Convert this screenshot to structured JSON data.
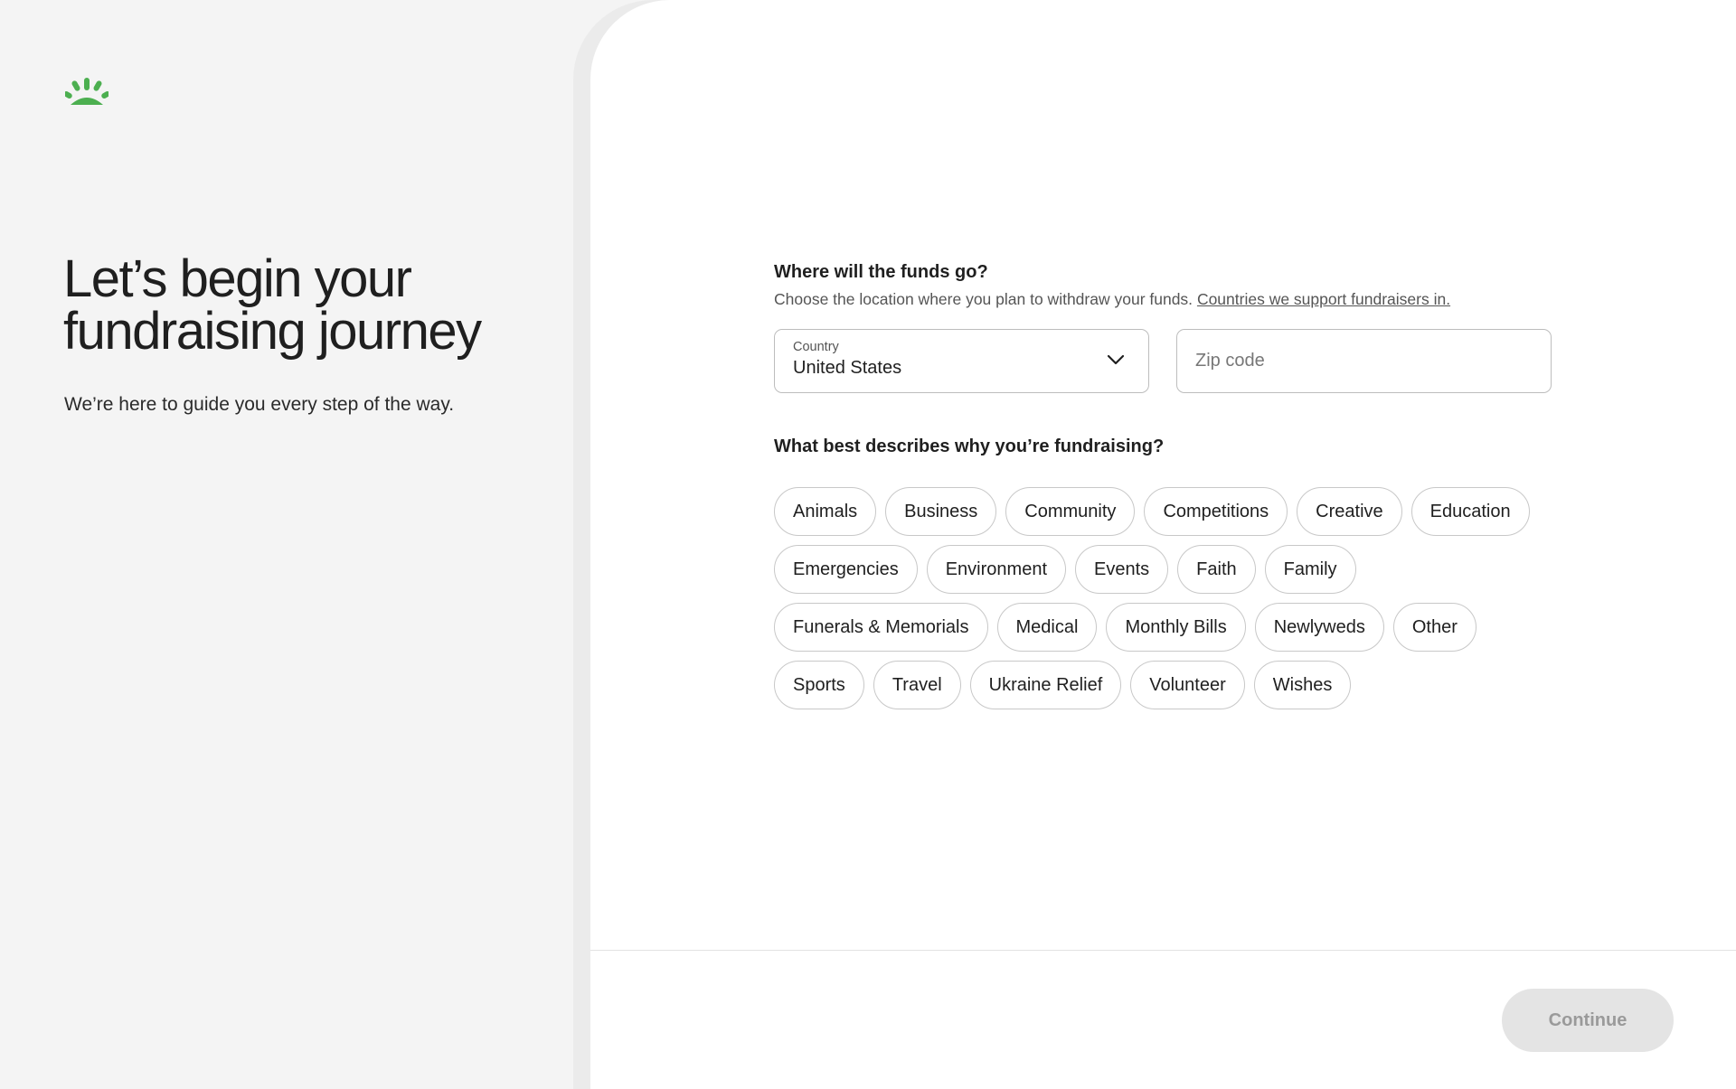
{
  "brand": {
    "logo_icon": "sunburst-logo-icon",
    "accent": "#4caf50"
  },
  "hero": {
    "headline": "Let’s begin your fundraising journey",
    "subline": "We’re here to guide you every step of the way."
  },
  "location": {
    "title": "Where will the funds go?",
    "description": "Choose the location where you plan to withdraw your funds.",
    "link": "Countries we support fundraisers in.",
    "country_label": "Country",
    "country_value": "United States",
    "zip_placeholder": "Zip code"
  },
  "category": {
    "title": "What best describes why you’re fundraising?",
    "options": [
      "Animals",
      "Business",
      "Community",
      "Competitions",
      "Creative",
      "Education",
      "Emergencies",
      "Environment",
      "Events",
      "Faith",
      "Family",
      "Funerals & Memorials",
      "Medical",
      "Monthly Bills",
      "Newlyweds",
      "Other",
      "Sports",
      "Travel",
      "Ukraine Relief",
      "Volunteer",
      "Wishes"
    ]
  },
  "footer": {
    "continue_label": "Continue"
  }
}
